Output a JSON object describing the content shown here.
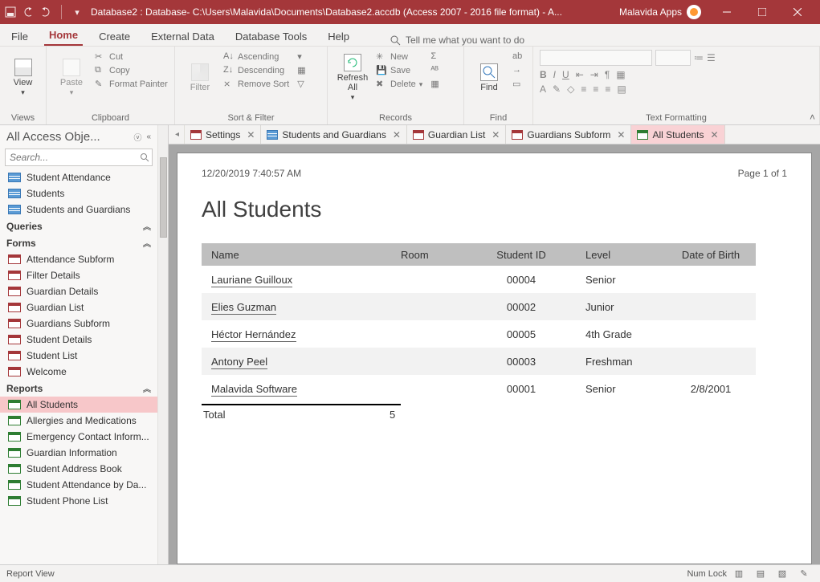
{
  "titlebar": {
    "title": "Database2 : Database- C:\\Users\\Malavida\\Documents\\Database2.accdb (Access 2007 - 2016 file format) - A...",
    "apps_label": "Malavida Apps"
  },
  "menus": {
    "file": "File",
    "home": "Home",
    "create": "Create",
    "external": "External Data",
    "tools": "Database Tools",
    "help": "Help",
    "tellme": "Tell me what you want to do"
  },
  "ribbon": {
    "views": {
      "label": "Views",
      "view": "View"
    },
    "clipboard": {
      "label": "Clipboard",
      "paste": "Paste",
      "cut": "Cut",
      "copy": "Copy",
      "painter": "Format Painter"
    },
    "sortfilter": {
      "label": "Sort & Filter",
      "filter": "Filter",
      "asc": "Ascending",
      "desc": "Descending",
      "remove": "Remove Sort"
    },
    "records": {
      "label": "Records",
      "refresh": "Refresh\nAll",
      "new": "New",
      "save": "Save",
      "delete": "Delete"
    },
    "find": {
      "label": "Find",
      "find": "Find"
    },
    "textfmt": {
      "label": "Text Formatting"
    }
  },
  "nav": {
    "title": "All Access Obje...",
    "search_ph": "Search...",
    "tables_visible": [
      "Student Attendance",
      "Students",
      "Students and Guardians"
    ],
    "queries": "Queries",
    "forms_title": "Forms",
    "forms": [
      "Attendance Subform",
      "Filter Details",
      "Guardian Details",
      "Guardian List",
      "Guardians Subform",
      "Student Details",
      "Student List",
      "Welcome"
    ],
    "reports_title": "Reports",
    "reports": [
      "All Students",
      "Allergies and Medications",
      "Emergency Contact Inform...",
      "Guardian Information",
      "Student Address Book",
      "Student Attendance by Da...",
      "Student Phone List"
    ]
  },
  "tabs": [
    {
      "label": "Settings",
      "type": "frm"
    },
    {
      "label": "Students and Guardians",
      "type": "tbl"
    },
    {
      "label": "Guardian List",
      "type": "frm"
    },
    {
      "label": "Guardians Subform",
      "type": "frm"
    },
    {
      "label": "All Students",
      "type": "rpt",
      "active": true
    }
  ],
  "page": {
    "timestamp": "12/20/2019 7:40:57 AM",
    "pagenum": "Page 1 of 1",
    "title": "All Students",
    "headers": {
      "name": "Name",
      "room": "Room",
      "sid": "Student ID",
      "level": "Level",
      "dob": "Date of Birth"
    },
    "rows": [
      {
        "name": "Lauriane Guilloux",
        "room": "",
        "sid": "00004",
        "level": "Senior",
        "dob": ""
      },
      {
        "name": "Elies Guzman",
        "room": "",
        "sid": "00002",
        "level": "Junior",
        "dob": ""
      },
      {
        "name": "Héctor Hernández",
        "room": "",
        "sid": "00005",
        "level": "4th Grade",
        "dob": ""
      },
      {
        "name": "Antony Peel",
        "room": "",
        "sid": "00003",
        "level": "Freshman",
        "dob": ""
      },
      {
        "name": "Malavida Software",
        "room": "",
        "sid": "00001",
        "level": "Senior",
        "dob": "2/8/2001"
      }
    ],
    "total_label": "Total",
    "total_count": "5"
  },
  "status": {
    "view": "Report View",
    "numlock": "Num Lock"
  }
}
